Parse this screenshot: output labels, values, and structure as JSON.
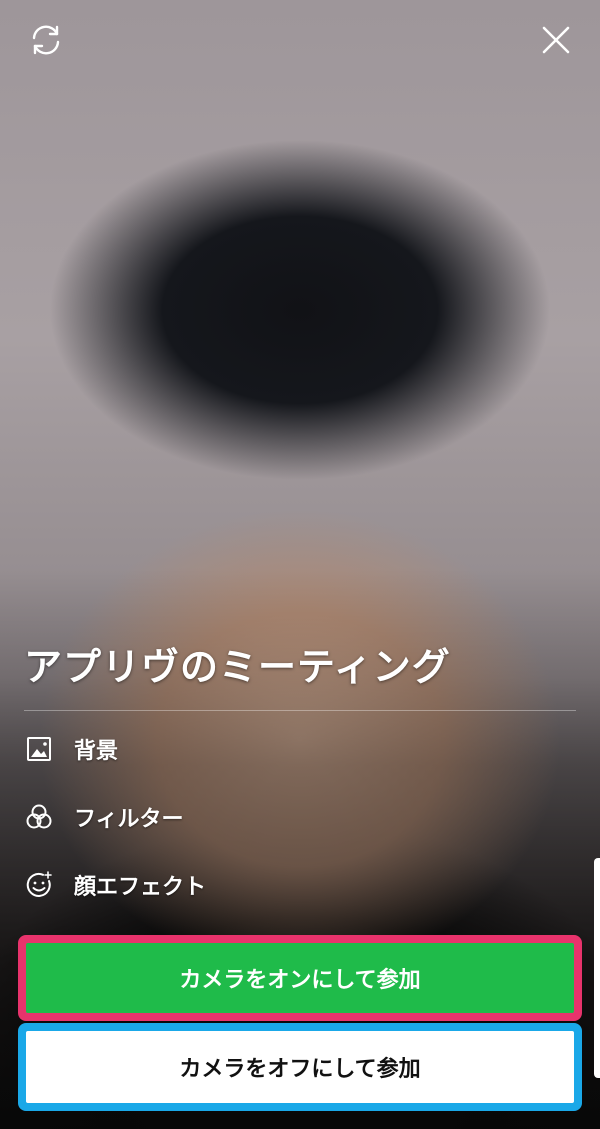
{
  "header": {
    "flip_icon": "camera-flip-icon",
    "close_icon": "close-icon"
  },
  "meeting": {
    "title": "アプリヴのミーティング"
  },
  "menu": {
    "items": [
      {
        "icon": "background-image-icon",
        "label": "背景"
      },
      {
        "icon": "filter-icon",
        "label": "フィルター"
      },
      {
        "icon": "face-effect-icon",
        "label": "顔エフェクト"
      }
    ]
  },
  "actions": {
    "join_camera_on": "カメラをオンにして参加",
    "join_camera_off": "カメラをオフにして参加"
  },
  "colors": {
    "join_on_bg": "#1fbb4a",
    "join_on_highlight": "#e8336c",
    "join_off_bg": "#ffffff",
    "join_off_highlight": "#1aa8e8"
  }
}
